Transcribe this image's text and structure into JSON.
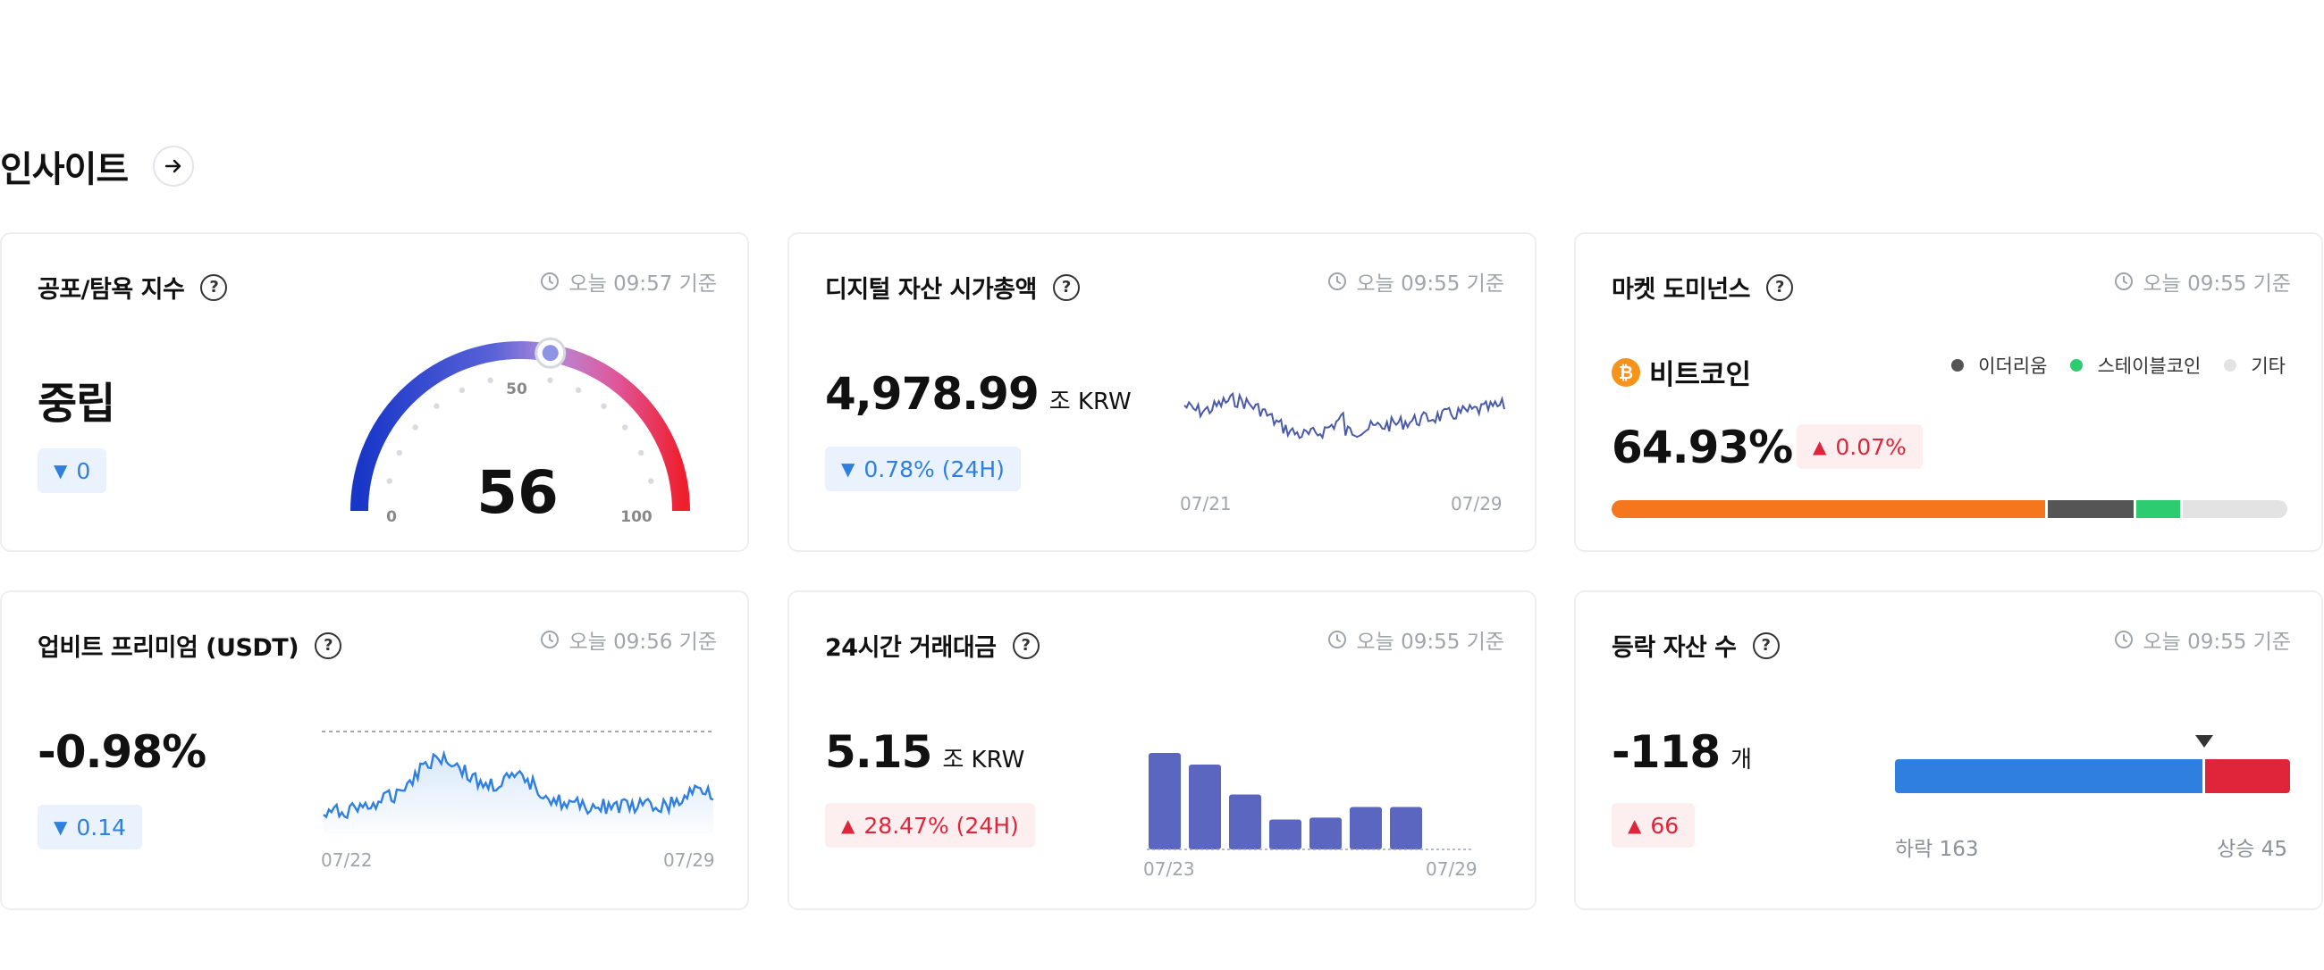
{
  "section": {
    "title": "인사이트"
  },
  "fear_greed": {
    "title": "공포/탐욕 지수",
    "timestamp": "오늘 09:57 기준",
    "status": "중립",
    "change": "0",
    "value": "56",
    "gauge_value": 56,
    "gauge_labels": {
      "min": "0",
      "mid": "50",
      "max": "100"
    }
  },
  "market_cap": {
    "title": "디지털 자산 시가총액",
    "timestamp": "오늘 09:55 기준",
    "value": "4,978.99",
    "unit": "조 KRW",
    "change": "0.78% (24H)",
    "x_start": "07/21",
    "x_end": "07/29"
  },
  "dominance": {
    "title": "마켓 도미넌스",
    "timestamp": "오늘 09:55 기준",
    "coin": "비트코인",
    "value": "64.93%",
    "change": "0.07%",
    "legend": [
      {
        "label": "이더리움",
        "color": "#555555"
      },
      {
        "label": "스테이블코인",
        "color": "#2ecc71"
      },
      {
        "label": "기타",
        "color": "#e3e3e3"
      }
    ],
    "bar": [
      {
        "name": "bitcoin",
        "percent": 64.93,
        "color": "#f6761d"
      },
      {
        "name": "ethereum",
        "percent": 12.8,
        "color": "#555555"
      },
      {
        "name": "stablecoin",
        "percent": 6.6,
        "color": "#2ecc71"
      },
      {
        "name": "other",
        "percent": 15.67,
        "color": "#e3e3e3"
      }
    ]
  },
  "premium": {
    "title": "업비트 프리미엄 (USDT)",
    "timestamp": "오늘 09:56 기준",
    "value": "-0.98%",
    "change": "0.14",
    "x_start": "07/22",
    "x_end": "07/29"
  },
  "volume": {
    "title": "24시간 거래대금",
    "timestamp": "오늘 09:55 기준",
    "value": "5.15",
    "unit": "조 KRW",
    "change": "28.47% (24H)",
    "x_start": "07/23",
    "x_end": "07/29",
    "bars": [
      100,
      88,
      57,
      31,
      33,
      44,
      44
    ]
  },
  "advance_decline": {
    "title": "등락 자산 수",
    "timestamp": "오늘 09:55 기준",
    "value": "-118",
    "unit": "개",
    "change": "66",
    "down_label": "하락 163",
    "up_label": "상승 45",
    "down_count": 163,
    "up_count": 45
  }
}
